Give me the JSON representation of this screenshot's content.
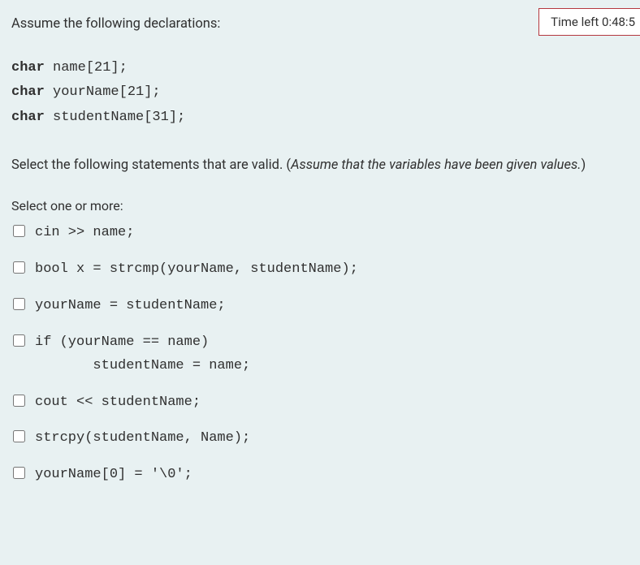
{
  "timer": {
    "label": "Time left 0:48:5"
  },
  "intro_text": "Assume the following declarations:",
  "declarations": {
    "line1_kw": "char",
    "line1_rest": " name[21];",
    "line2_kw": "char",
    "line2_rest": " yourName[21];",
    "line3_kw": "char",
    "line3_rest": " studentName[31];"
  },
  "question": {
    "plain_a": "Select the following statements that are valid. (",
    "italic": "Assume that the variables have been given values.",
    "plain_b": ")"
  },
  "select_hint": "Select one or more:",
  "options": {
    "opt1": "cin >> name;",
    "opt2": "bool x = strcmp(yourName, studentName);",
    "opt3": "yourName = studentName;",
    "opt4": "if (yourName == name)\n       studentName = name;",
    "opt5": "cout << studentName;",
    "opt6": "strcpy(studentName, Name);",
    "opt7": "yourName[0] = '\\0';"
  }
}
